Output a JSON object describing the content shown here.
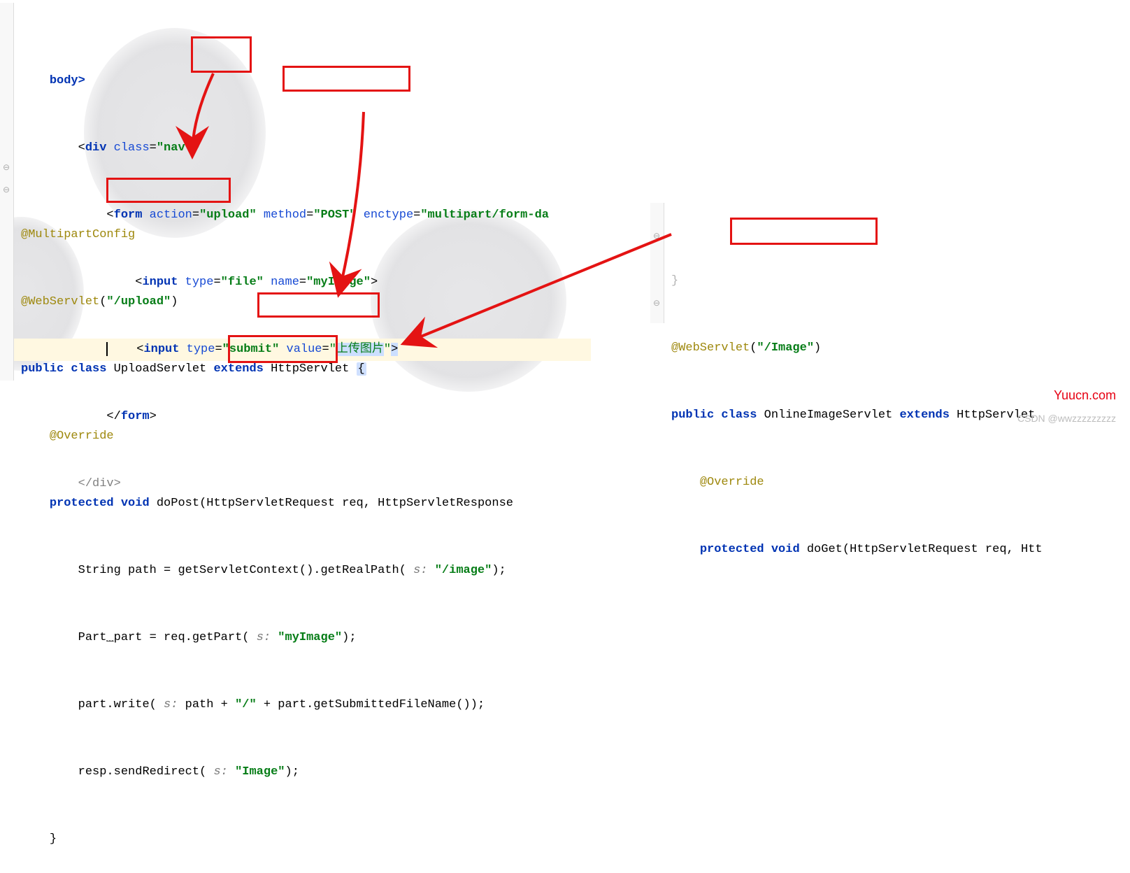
{
  "html_block": {
    "line1_body": "body>",
    "div_open": {
      "tag": "div",
      "attr1": "class",
      "val1": "\"nav\""
    },
    "form_open": {
      "tag": "form",
      "attr_action": "action",
      "val_action": "\"upload\"",
      "attr_method": "method",
      "val_method": "\"POST\"",
      "attr_enctype": "enctype",
      "val_enctype": "\"multipart/form-da"
    },
    "input1": {
      "tag": "input",
      "attr_type": "type",
      "val_type": "\"file\"",
      "attr_name": "name",
      "val_name": "\"myImage\""
    },
    "input2": {
      "tag": "input",
      "attr_type": "type",
      "val_type": "\"submit\"",
      "attr_value": "value",
      "val_value": "\"上传图片\""
    },
    "form_close": "form",
    "div_close": "</div>"
  },
  "java_block": {
    "ann1": "@MultipartConfig",
    "ann2": "@WebServlet",
    "ann2_arg": "\"/upload\"",
    "class_decl": {
      "kw1": "public",
      "kw2": "class",
      "name": "UploadServlet",
      "kw3": "extends",
      "super": "HttpServlet"
    },
    "override": "@Override",
    "method_decl": {
      "kw1": "protected",
      "kw2": "void",
      "name": "doPost",
      "p1t": "HttpServletRequest",
      "p1n": "req",
      "p2t": "HttpServletResponse"
    },
    "l1": {
      "a": "String path = getServletContext().getRealPath(",
      "hint": "s:",
      "str": "\"/image\"",
      "b": ");"
    },
    "l2": {
      "a": "Part",
      "u": "_",
      "b": "part = req.getPart(",
      "hint": "s:",
      "str": "\"myImage\"",
      "c": ");"
    },
    "l3": {
      "a": "part.write(",
      "hint": "s:",
      "b": "path + ",
      "str1": "\"/\"",
      "c": " + part.getSubmittedFileName());"
    },
    "l4": {
      "a": "resp.sendRedirect(",
      "hint": "s:",
      "str": "\"Image\"",
      "b": ");"
    },
    "close": "}"
  },
  "right_block": {
    "paren": "}",
    "ann": "@WebServlet",
    "ann_arg": "\"/Image\"",
    "class_decl": {
      "kw1": "public",
      "kw2": "class",
      "name": "OnlineImageServlet",
      "kw3": "extends",
      "super": "HttpServlet"
    },
    "override": "@Override",
    "method_decl": {
      "kw1": "protected",
      "kw2": "void",
      "name": "doGet",
      "p1t": "HttpServletRequest",
      "p1n": "req",
      "p2": "Htt"
    }
  },
  "watermarks": {
    "yuucn": "Yuucn.com",
    "csdn": "CSDN @wwzzzzzzzzz"
  }
}
